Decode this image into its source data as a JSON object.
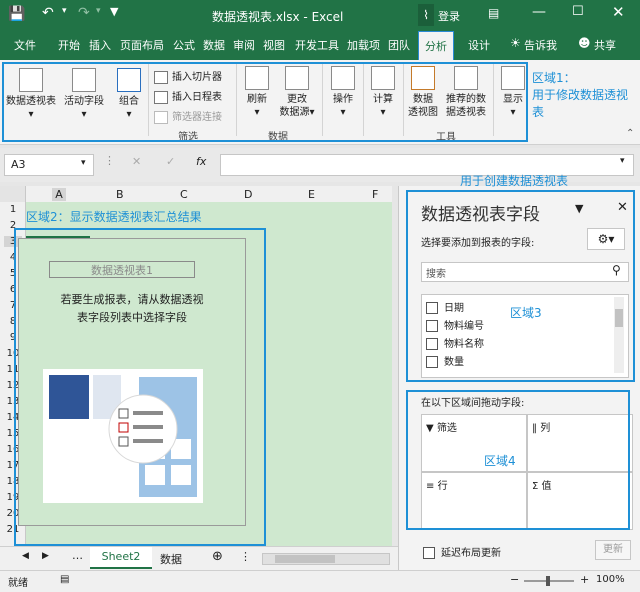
{
  "window": {
    "title": "数据透视表.xlsx - Excel",
    "login": "登录"
  },
  "ribbon_tabs": [
    "文件",
    "开始",
    "插入",
    "页面布局",
    "公式",
    "数据",
    "审阅",
    "视图",
    "开发工具",
    "加载项",
    "团队",
    "分析",
    "设计"
  ],
  "tell_me": "告诉我",
  "share": "共享",
  "ribbon": {
    "pivot_table": "数据透视表",
    "active_field": "活动字段",
    "group": "组合",
    "insert_slicer": "插入切片器",
    "insert_timeline": "插入日程表",
    "filter_connections": "筛选器连接",
    "filter_group": "筛选",
    "refresh": "刷新",
    "change_source_1": "更改",
    "change_source_2": "数据源",
    "data_group": "数据",
    "actions": "操作",
    "calculate": "计算",
    "pivot_chart_1": "数据",
    "pivot_chart_2": "透视图",
    "recommended_1": "推荐的数",
    "recommended_2": "据透视表",
    "tools_group": "工具",
    "show": "显示"
  },
  "formula_bar": {
    "name_box": "A3",
    "fx": "fx"
  },
  "grid": {
    "columns": [
      "A",
      "B",
      "C",
      "D",
      "E",
      "F"
    ],
    "rows": [
      "1",
      "2",
      "3",
      "4",
      "5",
      "6",
      "7",
      "8",
      "9",
      "10",
      "11",
      "12",
      "13",
      "14",
      "15",
      "16",
      "17",
      "18",
      "19",
      "20",
      "21"
    ],
    "placeholder_title": "数据透视表1",
    "placeholder_line1": "若要生成报表，请从数据透视",
    "placeholder_line2": "表字段列表中选择字段"
  },
  "annotations": {
    "area1_line1": "区域1：",
    "area1_line2": "用于修改数据透视",
    "area1_line3": "表",
    "area2": "区域2：显示数据透视表汇总结果",
    "area3": "区域3",
    "area4": "区域4",
    "create_pivot": "用于创建数据透视表"
  },
  "pane": {
    "title": "数据透视表字段",
    "choose_fields": "选择要添加到报表的字段:",
    "search_placeholder": "搜索",
    "fields": [
      "日期",
      "物料编号",
      "物料名称",
      "数量"
    ],
    "drag_label": "在以下区域间拖动字段:",
    "filter": "筛选",
    "columns": "列",
    "rows": "行",
    "values": "值",
    "defer": "延迟布局更新",
    "update": "更新"
  },
  "sheets": [
    "Sheet2",
    "数据"
  ],
  "status": {
    "ready": "就绪",
    "zoom": "100%"
  },
  "colors": {
    "excel_green": "#217346",
    "annotation_blue": "#1e90d6",
    "sheet_fill": "#cfe8cf"
  }
}
